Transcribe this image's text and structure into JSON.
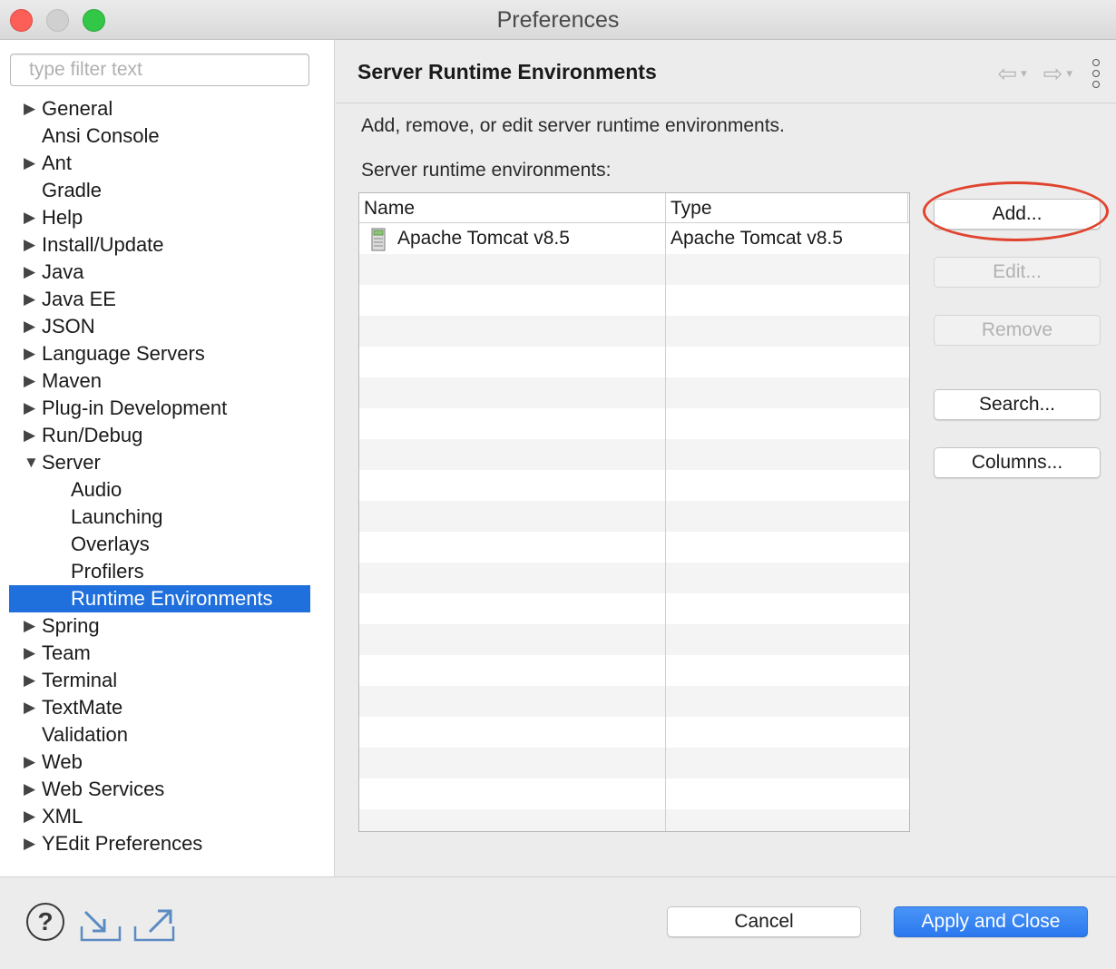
{
  "window": {
    "title": "Preferences"
  },
  "sidebar": {
    "filter_placeholder": "type filter text",
    "items": [
      {
        "label": "General",
        "expandable": true
      },
      {
        "label": "Ansi Console",
        "expandable": false
      },
      {
        "label": "Ant",
        "expandable": true
      },
      {
        "label": "Gradle",
        "expandable": false
      },
      {
        "label": "Help",
        "expandable": true
      },
      {
        "label": "Install/Update",
        "expandable": true
      },
      {
        "label": "Java",
        "expandable": true
      },
      {
        "label": "Java EE",
        "expandable": true
      },
      {
        "label": "JSON",
        "expandable": true
      },
      {
        "label": "Language Servers",
        "expandable": true
      },
      {
        "label": "Maven",
        "expandable": true
      },
      {
        "label": "Plug-in Development",
        "expandable": true
      },
      {
        "label": "Run/Debug",
        "expandable": true
      },
      {
        "label": "Server",
        "expandable": true,
        "expanded": true
      },
      {
        "label": "Audio",
        "child": true
      },
      {
        "label": "Launching",
        "child": true
      },
      {
        "label": "Overlays",
        "child": true
      },
      {
        "label": "Profilers",
        "child": true
      },
      {
        "label": "Runtime Environments",
        "child": true,
        "selected": true
      },
      {
        "label": "Spring",
        "expandable": true
      },
      {
        "label": "Team",
        "expandable": true
      },
      {
        "label": "Terminal",
        "expandable": true
      },
      {
        "label": "TextMate",
        "expandable": true
      },
      {
        "label": "Validation",
        "expandable": false
      },
      {
        "label": "Web",
        "expandable": true
      },
      {
        "label": "Web Services",
        "expandable": true
      },
      {
        "label": "XML",
        "expandable": true
      },
      {
        "label": "YEdit Preferences",
        "expandable": true
      }
    ]
  },
  "pane": {
    "title": "Server Runtime Environments",
    "description": "Add, remove, or edit server runtime environments.",
    "table_label": "Server runtime environments:",
    "columns": [
      "Name",
      "Type"
    ],
    "rows": [
      {
        "name": "Apache Tomcat v8.5",
        "type": "Apache Tomcat v8.5"
      }
    ],
    "buttons": {
      "add": "Add...",
      "edit": "Edit...",
      "remove": "Remove",
      "search": "Search...",
      "columns": "Columns..."
    }
  },
  "footer": {
    "cancel": "Cancel",
    "apply": "Apply and Close"
  },
  "colors": {
    "selection": "#1f6fdc",
    "highlight_circle": "#e0442f",
    "primary_button": "#2a78ee"
  }
}
